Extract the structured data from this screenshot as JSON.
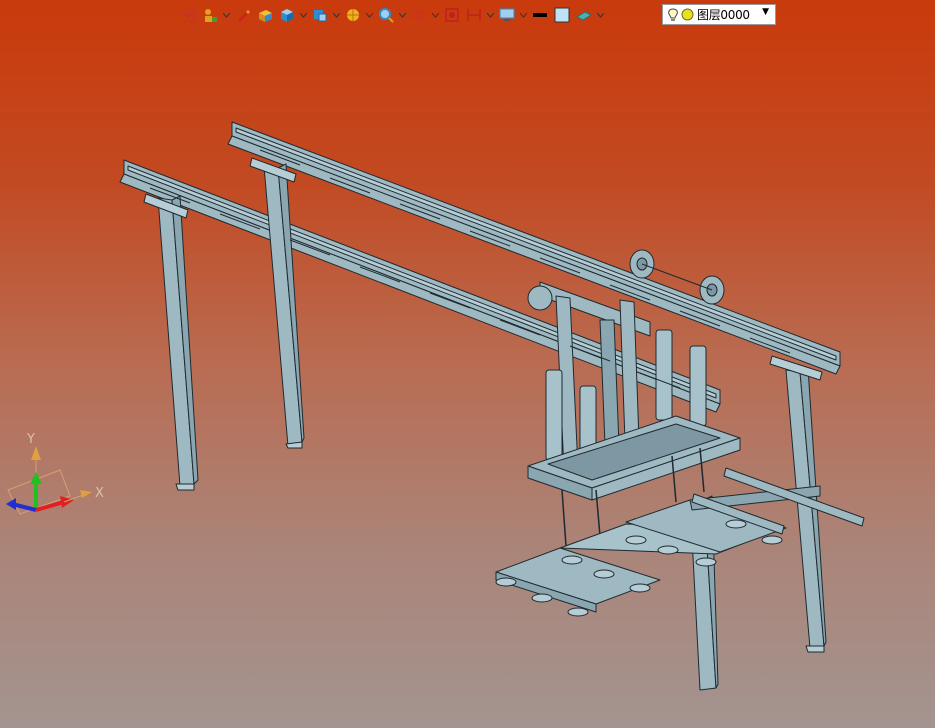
{
  "toolbar": {
    "items": [
      {
        "name": "exit-icon",
        "color": "#c83030"
      },
      {
        "name": "user-component-icon",
        "color": "#e0a020"
      },
      {
        "name": "edit-icon",
        "color": "#d02020"
      },
      {
        "name": "box-icon",
        "color": "#e0a020"
      },
      {
        "name": "view-cube-icon",
        "color": "#2f8ccf"
      },
      {
        "name": "render-icon",
        "color": "#2f8ccf"
      },
      {
        "name": "section-icon",
        "color": "#f0b020"
      },
      {
        "name": "zoom-icon",
        "color": "#2f8ccf"
      },
      {
        "name": "orbit-icon",
        "color": "#d03020"
      },
      {
        "name": "snapshot-icon",
        "color": "#c02020"
      },
      {
        "name": "measure-icon",
        "color": "#c02020"
      },
      {
        "name": "display-icon",
        "color": "#2f8ccf"
      }
    ],
    "line_color": "#000000",
    "fill_color": "#bfe0f5",
    "surface_color": "#4ab0b0"
  },
  "layer": {
    "name": "图层0000",
    "bulb_icon": "lightbulb-icon",
    "status_icon": "yellow-circle-icon"
  },
  "triad": {
    "x_label": "X",
    "y_label": "Y"
  },
  "colors": {
    "steel": "#9fb9c3",
    "steel_edge": "#1e2a30",
    "bg_top": "#c93a0c",
    "bg_bottom": "#a39490"
  }
}
